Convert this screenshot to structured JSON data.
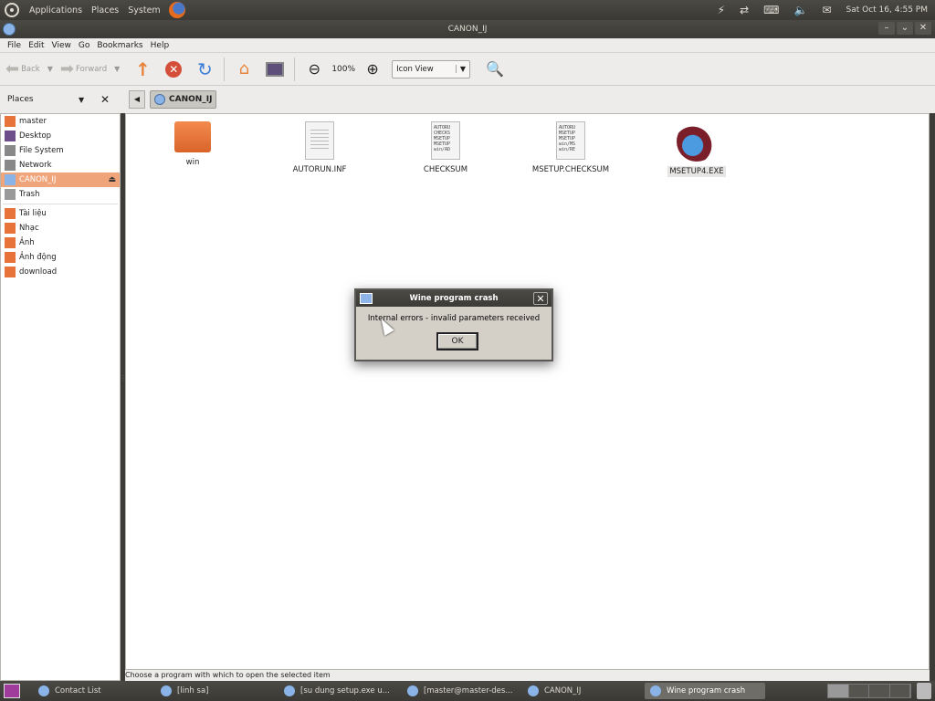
{
  "top_panel": {
    "menus": [
      "Applications",
      "Places",
      "System"
    ],
    "clock": "Sat Oct 16,  4:55 PM"
  },
  "window": {
    "title": "CANON_IJ"
  },
  "menubar": [
    "File",
    "Edit",
    "View",
    "Go",
    "Bookmarks",
    "Help"
  ],
  "toolbar": {
    "back_label": "Back",
    "forward_label": "Forward",
    "zoom": "100%",
    "view_mode": "Icon View"
  },
  "sidebar": {
    "header": "Places",
    "items": [
      {
        "label": "master",
        "icon": "home-icon",
        "color": "#e8733a"
      },
      {
        "label": "Desktop",
        "icon": "desktop-icon",
        "color": "#6e4e8a"
      },
      {
        "label": "File System",
        "icon": "harddisk-icon",
        "color": "#888888"
      },
      {
        "label": "Network",
        "icon": "network-icon",
        "color": "#888888"
      },
      {
        "label": "CANON_IJ",
        "icon": "cdrom-icon",
        "color": "#8ab4e8",
        "selected": true
      },
      {
        "label": "Trash",
        "icon": "trash-icon",
        "color": "#999999"
      },
      {
        "label": "Tài liệu",
        "icon": "folder-icon",
        "color": "#e8733a"
      },
      {
        "label": "Nhạc",
        "icon": "folder-icon",
        "color": "#e8733a"
      },
      {
        "label": "Ảnh",
        "icon": "folder-icon",
        "color": "#e8733a"
      },
      {
        "label": "Ảnh động",
        "icon": "folder-icon",
        "color": "#e8733a"
      },
      {
        "label": "download",
        "icon": "folder-icon",
        "color": "#e8733a"
      }
    ]
  },
  "location": {
    "crumb": "CANON_IJ"
  },
  "files": [
    {
      "name": "win",
      "kind": "folder"
    },
    {
      "name": "AUTORUN.INF",
      "kind": "document"
    },
    {
      "name": "CHECKSUM",
      "kind": "text",
      "preview": [
        "AUTORU",
        "CHECKS",
        "MSETUP",
        "MSETUP",
        "win/AD"
      ]
    },
    {
      "name": "MSETUP.CHECKSUM",
      "kind": "text",
      "preview": [
        "AUTORU",
        "MSETUP",
        "MSETUP",
        "win/MS",
        "win/RE"
      ]
    },
    {
      "name": "MSETUP4.EXE",
      "kind": "wine",
      "selected": true
    }
  ],
  "statusbar": {
    "text": "Choose a program with which to open the selected item"
  },
  "dialog": {
    "title": "Wine program crash",
    "message": "Internal errors - invalid parameters received",
    "ok": "OK"
  },
  "taskbar": [
    {
      "label": "Contact List"
    },
    {
      "label": "[linh sa]"
    },
    {
      "label": "[su dung setup.exe u..."
    },
    {
      "label": "[master@master-des..."
    },
    {
      "label": "CANON_IJ"
    },
    {
      "label": "Wine program crash",
      "active": true
    }
  ]
}
